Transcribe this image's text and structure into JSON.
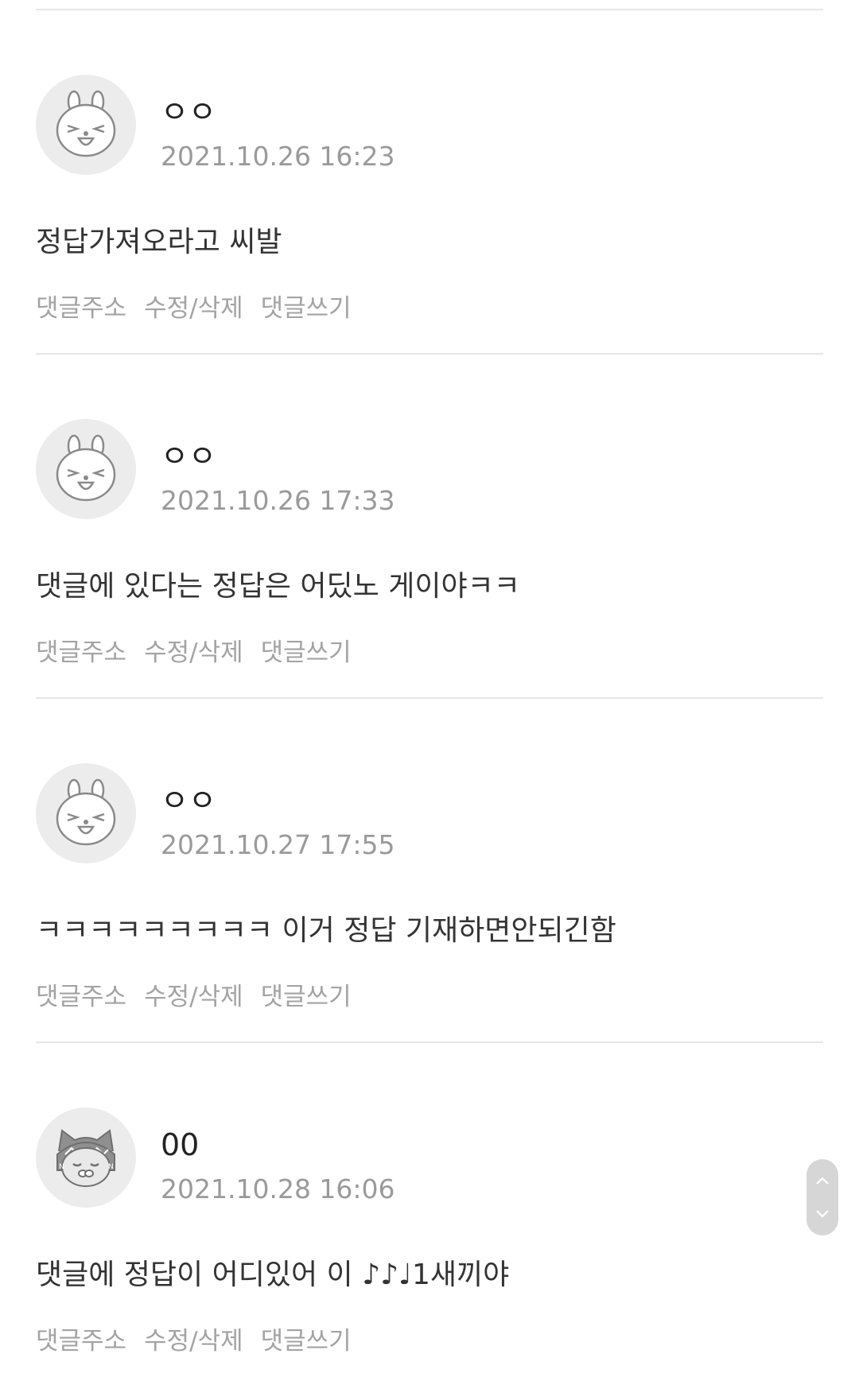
{
  "comments": [
    {
      "author": "ㅇㅇ",
      "timestamp": "2021.10.26 16:23",
      "text": "정답가져오라고 씨발",
      "avatar": "rabbit-avatar-icon"
    },
    {
      "author": "ㅇㅇ",
      "timestamp": "2021.10.26 17:33",
      "text": "댓글에 있다는 정답은 어딨노 게이야ㅋㅋ",
      "avatar": "rabbit-avatar-icon"
    },
    {
      "author": "ㅇㅇ",
      "timestamp": "2021.10.27 17:55",
      "text": "ㅋㅋㅋㅋㅋㅋㅋㅋㅋ 이거 정답 기재하면안되긴함",
      "avatar": "rabbit-avatar-icon"
    },
    {
      "author": "00",
      "timestamp": "2021.10.28 16:06",
      "text": "댓글에 정답이 어디있어 이 ♪♪♩1새끼야",
      "avatar": "cat-avatar-icon"
    }
  ],
  "actions": {
    "address": "댓글주소",
    "edit_delete": "수정/삭제",
    "reply": "댓글쓰기"
  },
  "scroll": {
    "up_icon": "chevron-up-icon",
    "down_icon": "chevron-down-icon"
  },
  "colors": {
    "divider": "#e6e6e6",
    "avatar_bg": "#ececec",
    "muted_text": "#9a9a9a",
    "body_text": "#333333"
  }
}
